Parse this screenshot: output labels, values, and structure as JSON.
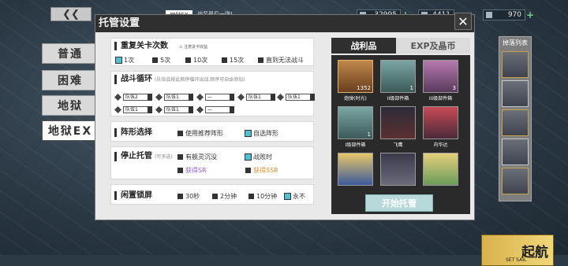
{
  "header": {
    "ex_tag": "地狱EX",
    "subtitle": "战至最后一弹!",
    "resources": [
      {
        "icon": "fuel-icon",
        "value": "32995"
      },
      {
        "icon": "ammo-icon",
        "value": "4411"
      },
      {
        "icon": "gem-icon",
        "value": "970"
      }
    ]
  },
  "difficulty": {
    "items": [
      {
        "label": "普通"
      },
      {
        "label": "困难"
      },
      {
        "label": "地狱"
      },
      {
        "label": "地狱EX"
      }
    ]
  },
  "panel": {
    "title": "托管设置",
    "repeat": {
      "title": "重复关卡次数",
      "warning": "注意关卡收益",
      "options": [
        "1次",
        "5次",
        "10次",
        "15次",
        "直到无法战斗"
      ]
    },
    "loop": {
      "title": "战斗循环",
      "note": "(队伍会按此顺序循环出战,顺序可自由添加)",
      "slots": [
        "队伍2",
        "队伍1",
        "—",
        "队伍1",
        "队伍1",
        "队伍1",
        "队伍1",
        "—"
      ]
    },
    "formation": {
      "title": "阵形选择",
      "options": [
        "使用推荐阵形",
        "自选阵形"
      ]
    },
    "stop": {
      "title": "停止托管",
      "note": "(可多选)",
      "options": [
        "有舰灵沉没",
        "战败时",
        "获得SR",
        "获得SSR"
      ]
    },
    "idle": {
      "title": "闲置锁屏",
      "options": [
        "30秒",
        "2分钟",
        "10分钟",
        "永不"
      ]
    }
  },
  "loot": {
    "tabs": [
      "战利品",
      "EXP及晶币"
    ],
    "items": [
      {
        "label": "炮弹(时光)",
        "count": "1352"
      },
      {
        "label": "II级部件箱",
        "count": "1"
      },
      {
        "label": "III级部件箱",
        "count": "3"
      },
      {
        "label": "I级部件箱",
        "count": "1"
      },
      {
        "label": "飞鹰",
        "count": ""
      },
      {
        "label": "内华达",
        "count": ""
      },
      {
        "label": "",
        "count": ""
      },
      {
        "label": "",
        "count": ""
      },
      {
        "label": "",
        "count": ""
      }
    ],
    "start_label": "开始托管"
  },
  "drops": {
    "title": "掉落列表"
  },
  "launch": {
    "label": "起航",
    "sub": "SET SAIL"
  },
  "colors": {
    "accent": "#4fc1d3",
    "purple": "#8a5cd6",
    "orange": "#e08a2a",
    "panel": "#e9e9e9",
    "dark": "#2f2f2f"
  }
}
